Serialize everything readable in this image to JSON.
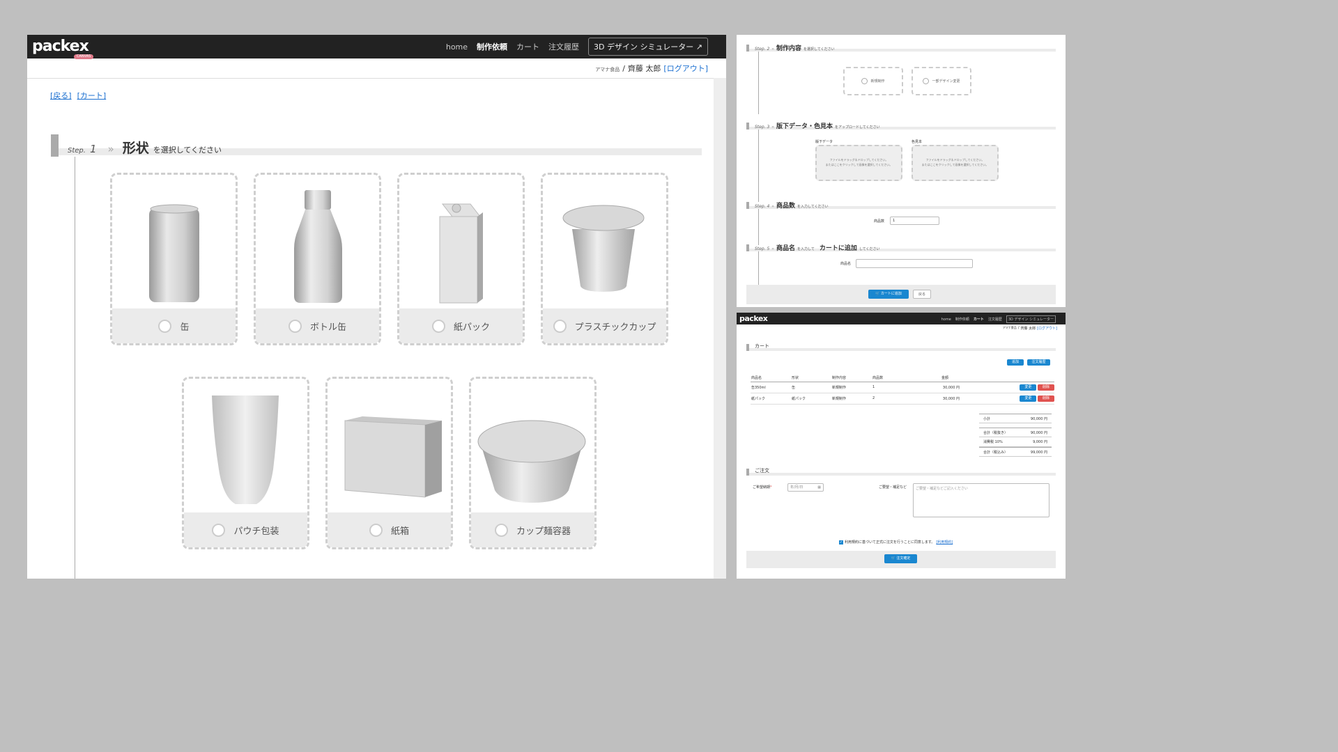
{
  "header": {
    "logo": "packex",
    "logo_sub": "CANVAS",
    "nav": [
      "home",
      "制作依頼",
      "カート",
      "注文履歴"
    ],
    "simulator": "3D デザイン シミュレーター"
  },
  "user": {
    "company": "アマナ食品",
    "separator": "/",
    "name": "齊藤 太郎",
    "logout": "[ログアウト]"
  },
  "links": {
    "back": "[戻る]",
    "cart": "[カート]"
  },
  "step1": {
    "step": "Step.",
    "num": "1",
    "title": "形状",
    "hint": "を選択してください"
  },
  "shapes": [
    "缶",
    "ボトル缶",
    "紙パック",
    "プラスチックカップ",
    "パウチ包装",
    "紙箱",
    "カップ麺容器"
  ],
  "step2": {
    "step": "Step. 2",
    "title": "制作内容",
    "hint": "を選択してください",
    "options": [
      "新規制作",
      "一部デザイン変更"
    ]
  },
  "step3": {
    "step": "Step. 3",
    "title": "版下データ・色見本",
    "hint": "をアップロードしてください",
    "fields": [
      "版下データ",
      "色見本"
    ],
    "drop_line1": "ファイルをドラッグ＆ドロップしてください。",
    "drop_line2": "またはここをクリックして画像を選択してください。"
  },
  "step4": {
    "step": "Step. 4",
    "title": "商品数",
    "hint": "を入力してください",
    "label": "商品数",
    "value": "1"
  },
  "step5": {
    "step": "Step. 5",
    "title": "商品名",
    "hint1": "を入力して",
    "title2": "カートに追加",
    "hint2": "してください",
    "label": "商品名"
  },
  "step_buttons": {
    "add": "カートに追加",
    "back": "戻る"
  },
  "cart": {
    "title": "カート",
    "top_buttons": [
      "追加",
      "注文履歴"
    ],
    "columns": [
      "商品名",
      "形状",
      "制作内容",
      "商品数",
      "金額"
    ],
    "rows": [
      {
        "name": "缶350ml",
        "shape": "缶",
        "type": "新規制作",
        "qty": "1",
        "price": "30,000 円"
      },
      {
        "name": "紙パック",
        "shape": "紙パック",
        "type": "新規制作",
        "qty": "2",
        "price": "30,000 円"
      }
    ],
    "row_buttons": {
      "edit": "変更",
      "delete": "削除"
    },
    "summary": [
      {
        "label": "小計",
        "value": "90,000 円"
      },
      {
        "label": "合計（税抜き）",
        "value": "90,000 円"
      },
      {
        "label": "消費税 10%",
        "value": "9,000 円"
      },
      {
        "label": "合計（税込み）",
        "value": "99,000 円"
      }
    ]
  },
  "order": {
    "title": "ご注文",
    "date_label": "ご希望納期",
    "required": "*",
    "date_placeholder": "年/月/日",
    "note_label": "ご要望・補足など",
    "note_placeholder": "ご要望・補足などご記入ください",
    "agree": "利用規約に基づいて正式に注文を行うことに同意します。",
    "terms": "[利用規約]",
    "confirm": "注文確定"
  },
  "colors": {
    "accent": "#1a87d0",
    "danger": "#e0524f",
    "header": "#222222"
  }
}
